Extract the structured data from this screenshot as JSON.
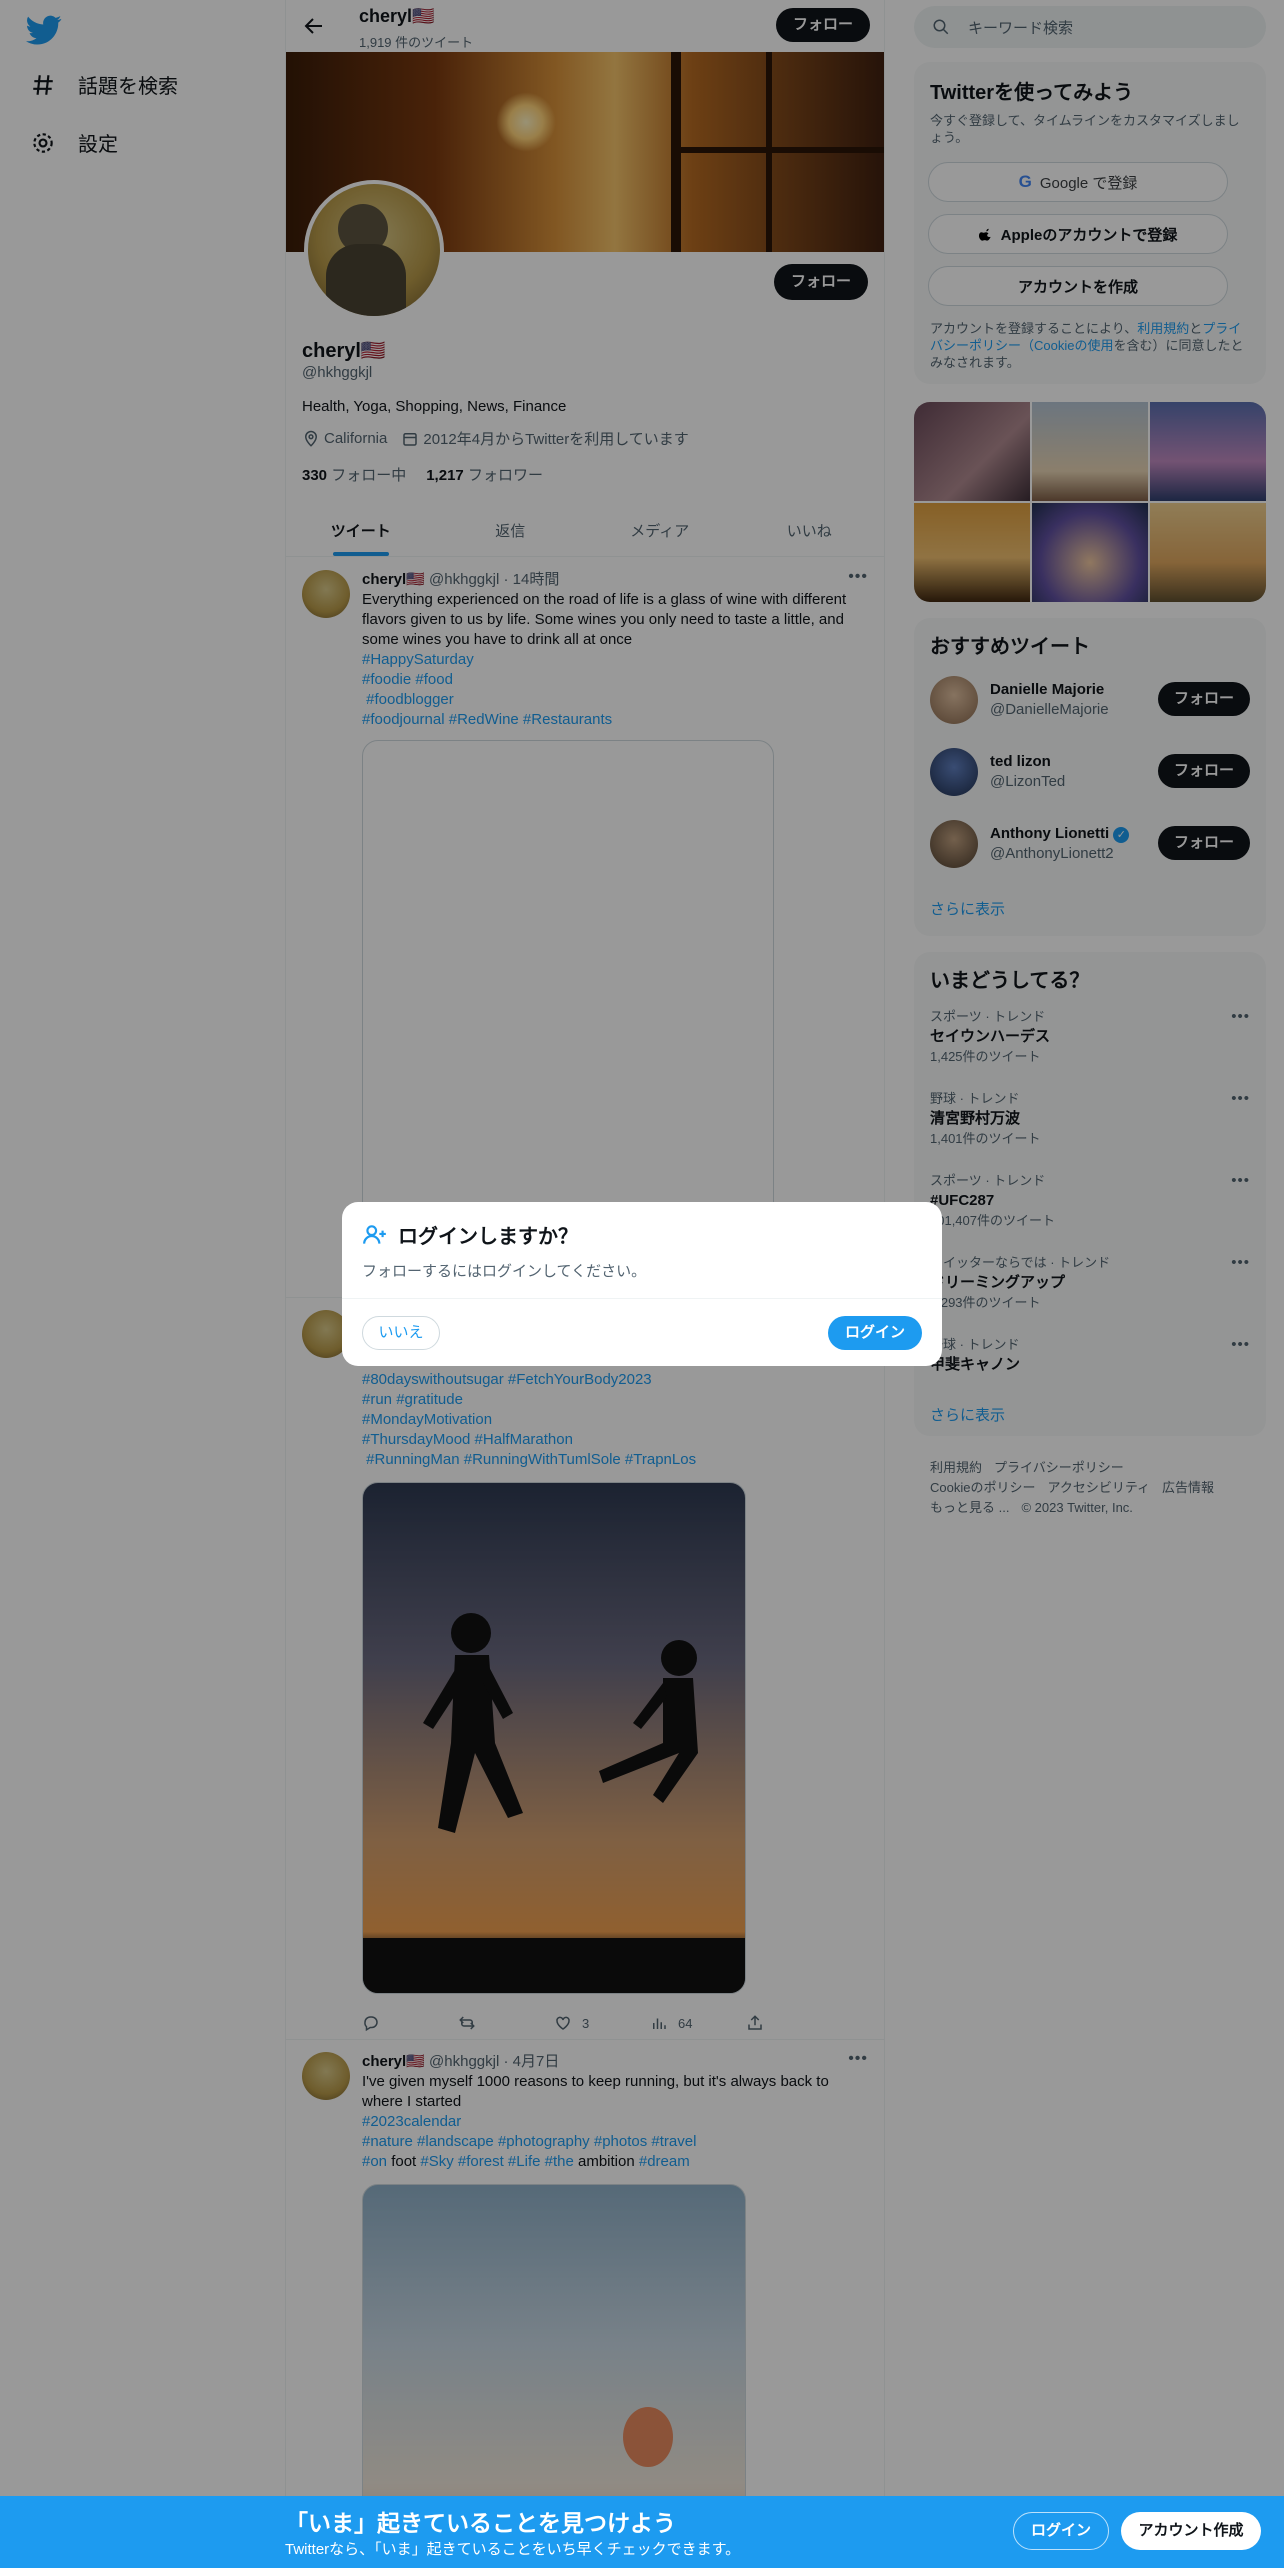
{
  "nav": {
    "explore": "話題を検索",
    "settings": "設定"
  },
  "profile": {
    "name": "cheryl🇺🇸",
    "tweet_count": "1,919 件のツイート",
    "follow_top": "フォロー",
    "follow_button": "フォロー",
    "handle": "@hkhggkjl",
    "bio": "Health, Yoga, Shopping, News, Finance",
    "location": "California",
    "joined": "2012年4月からTwitterを利用しています",
    "following_count": "330",
    "following_label": "フォロー中",
    "followers_count": "1,217",
    "followers_label": "フォロワー"
  },
  "tabs": [
    "ツイート",
    "返信",
    "メディア",
    "いいね"
  ],
  "tweets": [
    {
      "name": "cheryl🇺🇸",
      "handle": "@hkhggkjl",
      "time": "· 14時間",
      "text": "Everything experienced on the road of life is a glass of wine with different flavors given to us by life. Some wines you only need to taste a little, and some wines you have to drink all at once",
      "tags1": "#HappySaturday",
      "tags2": "#foodie #food",
      "tags3": " #foodblogger",
      "tags4": "#foodjournal #RedWine #Restaurants"
    },
    {
      "tags1": "#80dayswithoutsugar #FetchYourBody2023",
      "tags2": "#run #gratitude",
      "tags3": "#MondayMotivation",
      "tags4": "#ThursdayMood #HalfMarathon",
      "tags5": " #RunningMan #RunningWithTumlSole #TrapnLos",
      "likes": "3",
      "views": "64"
    },
    {
      "name": "cheryl🇺🇸",
      "handle": "@hkhggkjl",
      "time": "· 4月7日",
      "text": "I've given myself 1000 reasons to keep running, but it's always back to where I started",
      "tags1": "#2023calendar",
      "tags2": "#nature #landscape #photography #photos #travel",
      "tags3a": "#on",
      "w1": " foot ",
      "tags3b": "#Sky #forest #Life #the",
      "w2": " ambition ",
      "tags3c": "#dream"
    }
  ],
  "right": {
    "search_placeholder": "キーワード検索",
    "signup_title": "Twitterを使ってみよう",
    "signup_sub": "今すぐ登録して、タイムラインをカスタマイズしましょう。",
    "google": "Google で登録",
    "apple": "Appleのアカウントで登録",
    "create": "アカウントを作成",
    "terms_a": "アカウントを登録することにより、",
    "terms_b": "利用規約",
    "terms_c": "と",
    "terms_d": "プライバシーポリシー（Cookieの使用",
    "terms_e": "を含む）に同意したとみなされます。",
    "recommend_title": "おすすめツイート",
    "users": [
      {
        "name": "Danielle Majorie",
        "handle": "@DanielleMajorie",
        "btn": "フォロー"
      },
      {
        "name": "ted lizon",
        "handle": "@LizonTed",
        "btn": "フォロー"
      },
      {
        "name": "Anthony Lionetti",
        "handle": "@AnthonyLionett2",
        "btn": "フォロー"
      }
    ],
    "show_more": "さらに表示",
    "trends_title": "いまどうしてる？",
    "trends": [
      {
        "ctx": "スポーツ · トレンド",
        "title": "セイウンハーデス",
        "count": "1,425件のツイート"
      },
      {
        "ctx": "野球 · トレンド",
        "title": "清宮野村万波",
        "count": "1,401件のツイート"
      },
      {
        "ctx": "スポーツ · トレンド",
        "title": "#UFC287",
        "count": "101,407件のツイート"
      },
      {
        "ctx": "ツイッターならでは · トレンド",
        "title": "ドリーミングアップ",
        "count": "5,293件のツイート"
      },
      {
        "ctx": "野球 · トレンド",
        "title": "甲斐キャノン",
        "count": ""
      }
    ],
    "show_more2": "さらに表示",
    "footer": {
      "l1": "利用規約",
      "l2": "プライバシーポリシー",
      "l3": "Cookieのポリシー",
      "l4": "アクセシビリティ",
      "l5": "広告情報",
      "l6": "もっと見る ...",
      "l7": "© 2023 Twitter, Inc."
    }
  },
  "modal": {
    "title": "ログインしますか？",
    "body": "フォローするにはログインしてください。",
    "no": "いいえ",
    "yes": "ログイン"
  },
  "bottombar": {
    "title": "「いま」起きていることを見つけよう",
    "sub": "Twitterなら、「いま」起きていることをいち早くチェックできます。",
    "login": "ログイン",
    "signup": "アカウント作成"
  },
  "colors": {
    "accent": "#1d9bf0",
    "text": "#0f1419",
    "muted": "#536471"
  }
}
